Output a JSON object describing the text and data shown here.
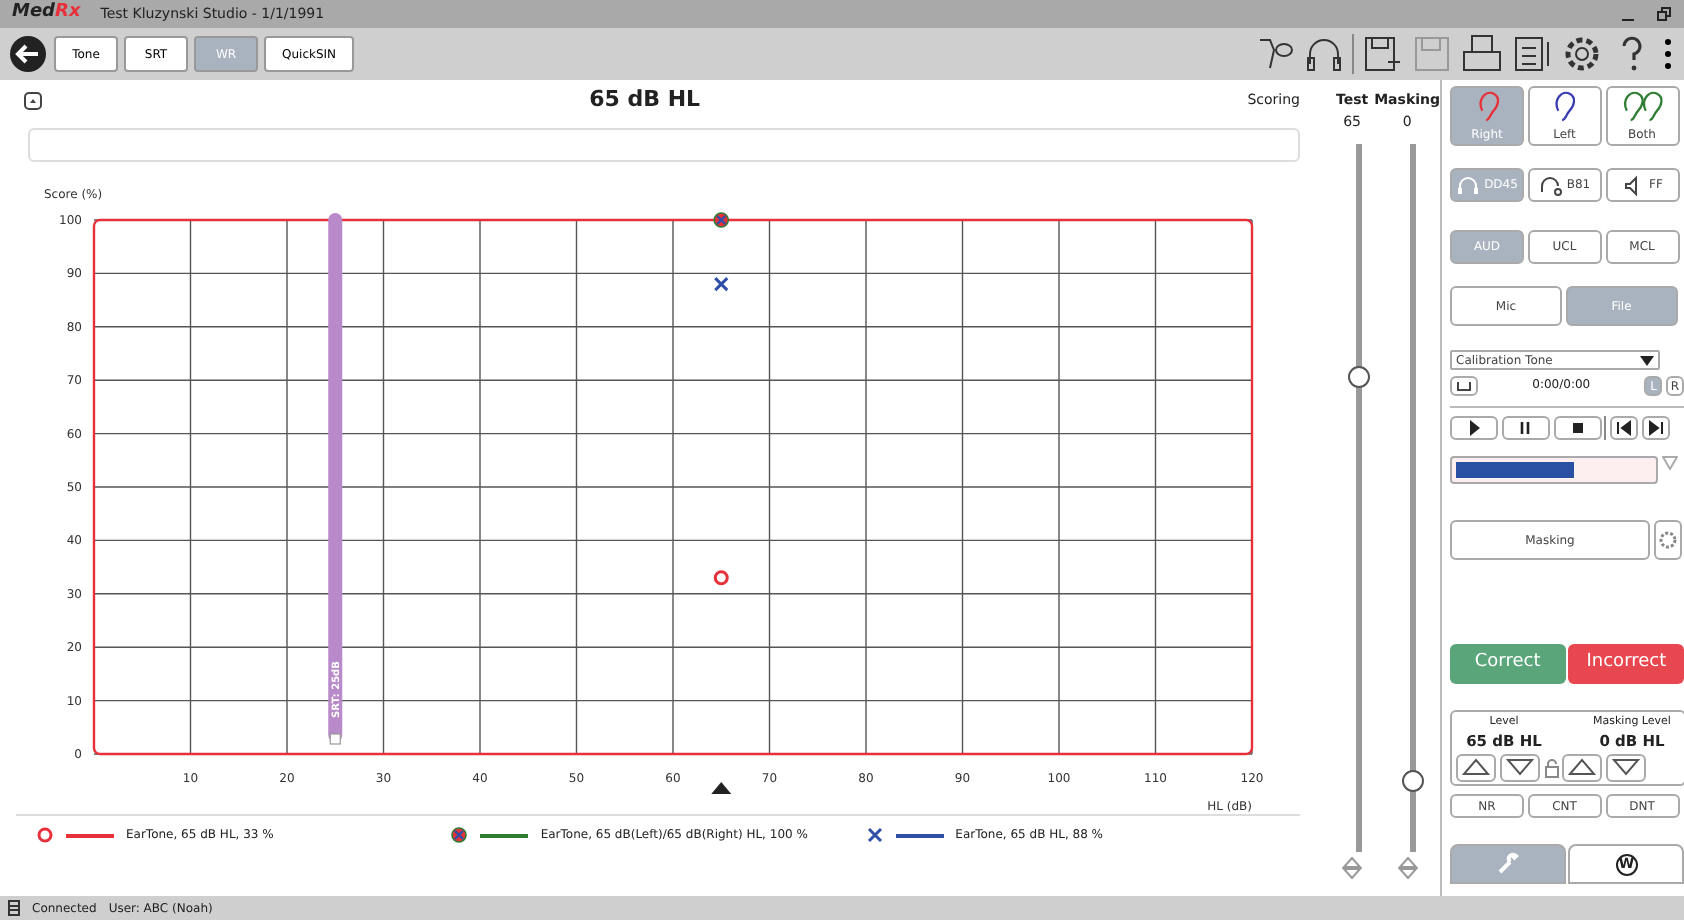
{
  "window": {
    "logo_main": "Med",
    "logo_accent": "Rx",
    "title": "Test Kluzynski Studio - 1/1/1991"
  },
  "tabs": [
    {
      "label": "Tone",
      "selected": false
    },
    {
      "label": "SRT",
      "selected": false
    },
    {
      "label": "WR",
      "selected": true
    },
    {
      "label": "QuickSIN",
      "selected": false
    }
  ],
  "header": {
    "title": "65 dB HL",
    "scoring_label": "Scoring"
  },
  "chart": {
    "markers": [
      {
        "kind": "circle"
      },
      {
        "kind": "circle-cross"
      },
      {
        "kind": "cross"
      }
    ],
    "chart_data": {
      "type": "scatter",
      "xlabel": "HL (dB)",
      "ylabel": "Score (%)",
      "xlim": [
        0,
        120
      ],
      "ylim": [
        0,
        100
      ],
      "xticks": [
        10,
        20,
        30,
        40,
        50,
        60,
        70,
        80,
        90,
        100,
        110,
        120
      ],
      "yticks": [
        0,
        10,
        20,
        30,
        40,
        50,
        60,
        70,
        80,
        90,
        100
      ],
      "grid": true,
      "x": [
        65
      ],
      "series": [
        {
          "name": "EarTone, 65 dB HL, 33 %",
          "color": "#e8303a",
          "values": [
            33
          ]
        },
        {
          "name": "EarTone, 65 dB(Left)/65 dB(Right) HL, 100 %",
          "color": "#2e7d32",
          "values": [
            100
          ]
        },
        {
          "name": "EarTone, 65 dB HL, 88 %",
          "color": "#2f4fa8",
          "values": [
            88
          ]
        }
      ],
      "ref_lines": [
        {
          "axis": "x",
          "value": 25,
          "label": "SRT: 25dB",
          "color": "#b98ac9"
        }
      ]
    }
  },
  "sliders": [
    {
      "label": "Test",
      "reading": "65",
      "level": 0.67
    },
    {
      "label": "Masking",
      "reading": "0",
      "level": 0.1
    }
  ],
  "ears": [
    {
      "label": "Right",
      "selected": true,
      "color": "#e8303a"
    },
    {
      "label": "Left",
      "selected": false,
      "color": "#3b3bb0"
    },
    {
      "label": "Both",
      "selected": false,
      "color": "#2e7d32"
    }
  ],
  "transducers": [
    {
      "label": "DD45",
      "selected": true,
      "kind": "headphone"
    },
    {
      "label": "B81",
      "selected": false,
      "kind": "bone"
    },
    {
      "label": "FF",
      "selected": false,
      "kind": "speaker"
    }
  ],
  "modes": [
    {
      "label": "AUD",
      "selected": true
    },
    {
      "label": "UCL",
      "selected": false
    },
    {
      "label": "MCL",
      "selected": false
    }
  ],
  "sources": [
    {
      "label": "Mic",
      "selected": false
    },
    {
      "label": "File",
      "selected": true
    }
  ],
  "file_player": {
    "track": "Calibration Tone",
    "time": "0:00/0:00",
    "channels": [
      {
        "label": "L",
        "selected": true
      },
      {
        "label": "R",
        "selected": false
      }
    ],
    "level": 0.6
  },
  "masking_button": "Masking",
  "responses": [
    {
      "label": "Correct",
      "kind": "correct"
    },
    {
      "label": "Incorrect",
      "kind": "incorrect"
    }
  ],
  "levels": [
    {
      "label": "Level",
      "reading": "65 dB HL"
    },
    {
      "label": "Masking Level",
      "reading": "0 dB HL"
    }
  ],
  "extra_buttons": [
    "NR",
    "CNT",
    "DNT"
  ],
  "bottom_tabs": [
    {
      "kind": "tools",
      "selected": true
    },
    {
      "kind": "letter",
      "selected": false,
      "label": "W"
    }
  ],
  "status_bar": {
    "connection": "Connected",
    "user": "User: ABC (Noah)"
  }
}
